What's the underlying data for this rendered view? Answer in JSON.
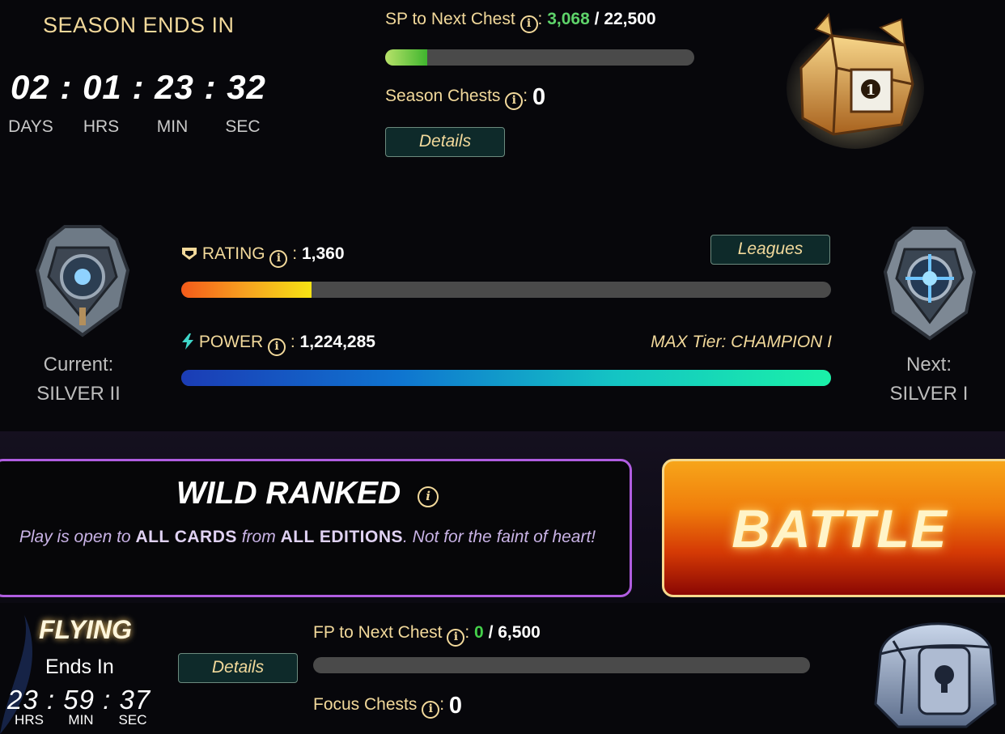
{
  "season": {
    "title": "SEASON ENDS IN",
    "timer": {
      "days": "02",
      "hrs": "01",
      "min": "23",
      "sec": "32",
      "sep": ":"
    },
    "units": {
      "days": "DAYS",
      "hrs": "HRS",
      "min": "MIN",
      "sec": "SEC"
    }
  },
  "sp": {
    "label": "SP to Next Chest",
    "current": "3,068",
    "total": "22,500",
    "separator": "/",
    "progress_fraction": 0.136
  },
  "season_chests": {
    "label": "Season Chests",
    "value": "0"
  },
  "details_button": "Details",
  "rating": {
    "label": "RATING",
    "value": "1,360",
    "progress_fraction": 0.2
  },
  "leagues_button": "Leagues",
  "power": {
    "label": "POWER",
    "value": "1,224,285",
    "max_tier": "MAX Tier: CHAMPION I",
    "progress_fraction": 1.0
  },
  "current_rank": {
    "label": "Current:",
    "name": "SILVER II"
  },
  "next_rank": {
    "label": "Next:",
    "name": "SILVER I"
  },
  "mode": {
    "title": "WILD RANKED",
    "desc_prefix": "Play is open to ",
    "desc_em1": "ALL CARDS",
    "desc_mid": " from ",
    "desc_em2": "ALL EDITIONS",
    "desc_suffix": ". Not for the faint of heart!"
  },
  "battle_button": "BATTLE",
  "focus": {
    "name": "FLYING",
    "ends_in": "Ends In",
    "timer": {
      "hrs": "23",
      "min": "59",
      "sec": "37",
      "sep": ":"
    },
    "units": {
      "hrs": "HRS",
      "min": "MIN",
      "sec": "SEC"
    },
    "details_button": "Details",
    "fp_label": "FP to Next Chest",
    "fp_current": "0",
    "fp_total": "6,500",
    "fp_separator": "/",
    "progress_fraction": 0,
    "chests_label": "Focus Chests",
    "chests_value": "0"
  },
  "icons": {
    "info": "info-icon",
    "rating": "rating-badge-icon",
    "power": "lightning-icon",
    "season_chest": "gold-chest-icon",
    "focus_chest": "silver-chest-icon",
    "current_rank": "silver-shield-icon",
    "next_rank": "silver-shield-icon"
  },
  "colors": {
    "gold_text": "#f2d99b",
    "sp_current": "#5ed36a",
    "fp_current": "#44d04a",
    "mode_border": "#b05de0",
    "battle_orange": "#f07e0b"
  }
}
